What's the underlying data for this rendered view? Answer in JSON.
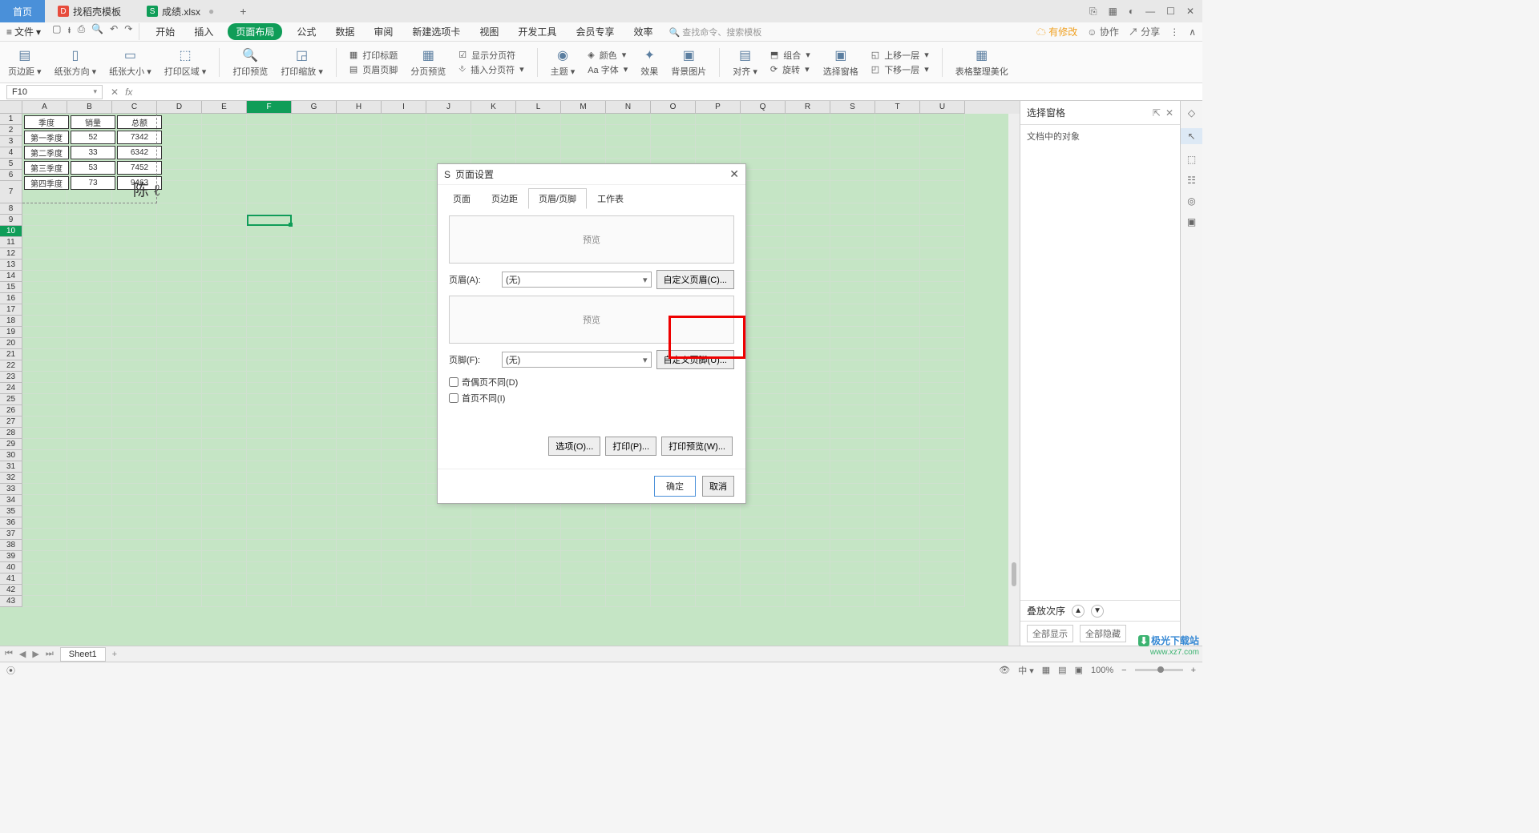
{
  "tabs": {
    "home": "首页",
    "template": "找稻壳模板",
    "file": "成绩.xlsx"
  },
  "menu": {
    "file": "文件",
    "items": [
      "开始",
      "插入",
      "页面布局",
      "公式",
      "数据",
      "审阅",
      "新建选项卡",
      "视图",
      "开发工具",
      "会员专享",
      "效率"
    ],
    "search": "查找命令、搜索模板",
    "right": {
      "sync": "有修改",
      "coop": "协作",
      "share": "分享"
    }
  },
  "ribbon": {
    "margin": "页边距",
    "orient": "纸张方向",
    "size": "纸张大小",
    "area": "打印区域",
    "preview": "打印预览",
    "scale": "打印缩放",
    "title": "打印标题",
    "headerfooter": "页眉页脚",
    "breaks": "分页预览",
    "insertbreak": "插入分页符",
    "showbreak": "显示分页符",
    "theme": "主题",
    "color": "颜色",
    "font": "Aa 字体",
    "effect": "效果",
    "bgimg": "背景图片",
    "align": "对齐",
    "group": "组合",
    "rotate": "旋转",
    "pane": "选择窗格",
    "forward": "上移一层",
    "backward": "下移一层",
    "beautify": "表格整理美化"
  },
  "cellref": {
    "name": "F10",
    "fx": ""
  },
  "columns": [
    "A",
    "B",
    "C",
    "D",
    "E",
    "F",
    "G",
    "H",
    "I",
    "J",
    "K",
    "L",
    "M",
    "N",
    "O",
    "P",
    "Q",
    "R",
    "S",
    "T",
    "U"
  ],
  "table": {
    "headers": [
      "季度",
      "销量",
      "总额"
    ],
    "rows": [
      [
        "第一季度",
        "52",
        "7342"
      ],
      [
        "第二季度",
        "33",
        "6342"
      ],
      [
        "第三季度",
        "53",
        "7452"
      ],
      [
        "第四季度",
        "73",
        "9463"
      ]
    ]
  },
  "panel": {
    "title": "选择窗格",
    "subtitle": "文档中的对象",
    "stackOrder": "叠放次序",
    "showAll": "全部显示",
    "hideAll": "全部隐藏"
  },
  "sheet": {
    "name": "Sheet1"
  },
  "status": {
    "zoom": "100%"
  },
  "dialog": {
    "title": "页面设置",
    "tabs": [
      "页面",
      "页边距",
      "页眉/页脚",
      "工作表"
    ],
    "preview": "预览",
    "headerLabel": "页眉(A):",
    "headerValue": "(无)",
    "customHeader": "自定义页眉(C)...",
    "footerLabel": "页脚(F):",
    "footerValue": "(无)",
    "customFooter": "自定义页脚(U)...",
    "oddEven": "奇偶页不同(D)",
    "firstPage": "首页不同(I)",
    "options": "选项(O)...",
    "print": "打印(P)...",
    "printPreview": "打印预览(W)...",
    "ok": "确定",
    "cancel": "取消"
  },
  "watermark": {
    "text": "极光下载站",
    "url": "www.xz7.com"
  }
}
